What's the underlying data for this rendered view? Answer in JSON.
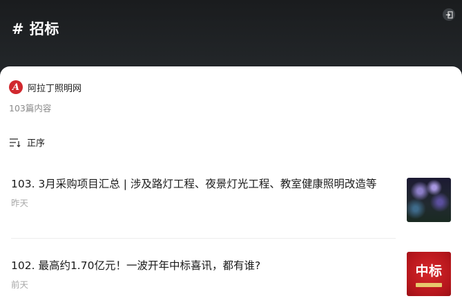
{
  "header": {
    "title": "# 招标",
    "exit_icon": "exit-icon"
  },
  "account": {
    "logo_letter": "A",
    "name": "阿拉丁照明网"
  },
  "summary": {
    "count_text": "103篇内容"
  },
  "sort": {
    "icon": "sort-icon",
    "label": "正序"
  },
  "articles": [
    {
      "title": "103. 3月采购项目汇总 | 涉及路灯工程、夜景灯光工程、教室健康照明改造等",
      "time": "昨天",
      "thumbnail": "night-scene-thumbnail"
    },
    {
      "title": "102. 最高约1.70亿元！一波开年中标喜讯，都有谁?",
      "time": "前天",
      "thumbnail": "award-thumbnail",
      "thumbnail_text": "中标"
    }
  ],
  "colors": {
    "header_bg": "#1c1f22",
    "logo_red": "#d1282e",
    "muted_text": "#8a8a8a"
  }
}
